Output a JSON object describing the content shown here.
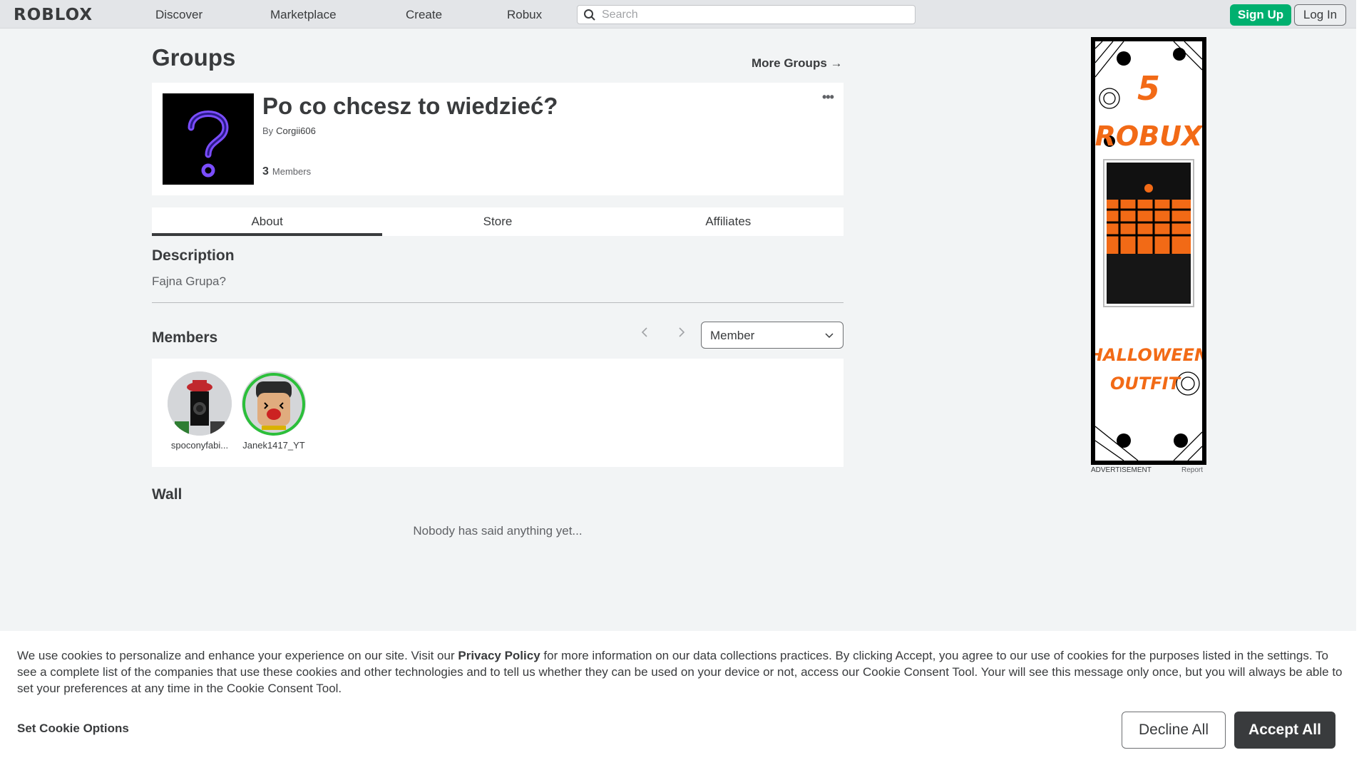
{
  "header": {
    "logo": "ROBLOX",
    "nav": [
      "Discover",
      "Marketplace",
      "Create",
      "Robux"
    ],
    "search_placeholder": "Search",
    "signup_label": "Sign Up",
    "login_label": "Log In"
  },
  "page": {
    "title": "Groups",
    "more_groups": "More Groups →"
  },
  "group": {
    "name": "Po co chcesz to wiedzieć?",
    "by_label": "By",
    "owner": "Corgii606",
    "member_count": "3",
    "members_label": "Members",
    "more_dots": "•••"
  },
  "tabs": [
    "About",
    "Store",
    "Affiliates"
  ],
  "about": {
    "description_title": "Description",
    "description_text": "Fajna Grupa?",
    "members_title": "Members",
    "role_selected": "Member",
    "members": [
      {
        "name": "spoconyfabi..."
      },
      {
        "name": "Janek1417_YT"
      }
    ],
    "wall_title": "Wall",
    "wall_empty": "Nobody has said anything yet..."
  },
  "ad": {
    "label": "ADVERTISEMENT",
    "report": "Report",
    "headline_num": "5",
    "headline_word": "ROBUX",
    "footer_line1": "HALLOWEEN",
    "footer_line2": "OUTFIT"
  },
  "cookie": {
    "text_before": "We use cookies to personalize and enhance your experience on our site. Visit our ",
    "privacy_link": "Privacy Policy",
    "text_after": " for more information on our data collections practices. By clicking Accept, you agree to our use of cookies for the purposes listed in the settings. To see a complete list of the companies that use these cookies and other technologies and to tell us whether they can be used on your device or not, access our Cookie Consent Tool. Your will see this message only once, but you will always be able to set your preferences at any time in the Cookie Consent Tool.",
    "set_options": "Set Cookie Options",
    "decline_label": "Decline All",
    "accept_label": "Accept All"
  },
  "colors": {
    "accent_green": "#00b06f",
    "text_dark": "#393b3d",
    "background": "#f2f4f5",
    "ad_orange": "#f26a16"
  }
}
